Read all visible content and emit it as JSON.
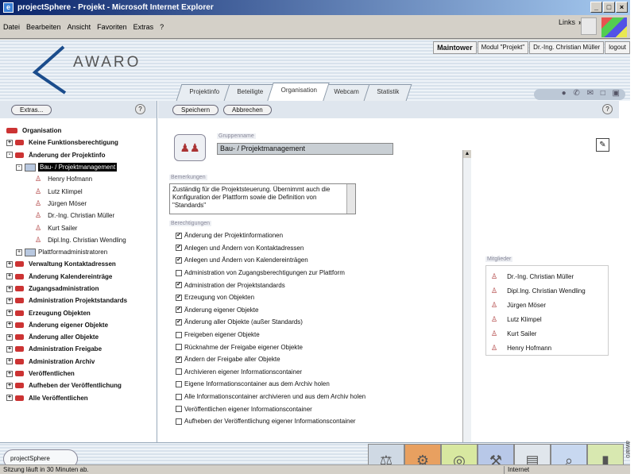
{
  "window": {
    "title": "projectSphere - Projekt - Microsoft Internet Explorer",
    "controls": [
      "_",
      "□",
      "×"
    ]
  },
  "menu": {
    "items": [
      "Datei",
      "Bearbeiten",
      "Ansicht",
      "Favoriten",
      "Extras",
      "?"
    ],
    "links": "Links",
    "links_chevron": "»"
  },
  "header": {
    "brand": "AWARO",
    "maintower": "Maintower",
    "modul": "Modul \"Projekt\"",
    "user": "Dr.-Ing. Christian Müller",
    "logout": "logout"
  },
  "tabs": [
    {
      "label": "Projektinfo"
    },
    {
      "label": "Beteiligte"
    },
    {
      "label": "Organisation"
    },
    {
      "label": "Webcam"
    },
    {
      "label": "Statistik"
    }
  ],
  "icons_strip": "● ✆ ✉ □ ▣",
  "left": {
    "extras": "Extras...",
    "help": "?",
    "root": "Organisation",
    "items": [
      {
        "label": "Keine Funktionsberechtigung",
        "type": "group",
        "level": 1
      },
      {
        "label": "Änderung der Projektinfo",
        "type": "group",
        "level": 1,
        "open": true
      },
      {
        "label": "Bau- / Projektmanagement",
        "type": "sub",
        "level": 2,
        "selected": true
      },
      {
        "label": "Henry Hofmann",
        "type": "person",
        "level": 3
      },
      {
        "label": "Lutz Klimpel",
        "type": "person",
        "level": 3
      },
      {
        "label": "Jürgen Möser",
        "type": "person",
        "level": 3
      },
      {
        "label": "Dr.-Ing. Christian Müller",
        "type": "person",
        "level": 3
      },
      {
        "label": "Kurt Sailer",
        "type": "person",
        "level": 3
      },
      {
        "label": "Dipl.Ing. Christian Wendling",
        "type": "person",
        "level": 3
      },
      {
        "label": "Plattformadministratoren",
        "type": "sub",
        "level": 2
      },
      {
        "label": "Verwaltung Kontaktadressen",
        "type": "group",
        "level": 1
      },
      {
        "label": "Änderung Kalendereinträge",
        "type": "group",
        "level": 1
      },
      {
        "label": "Zugangsadministration",
        "type": "group",
        "level": 1
      },
      {
        "label": "Administration Projektstandards",
        "type": "group",
        "level": 1
      },
      {
        "label": "Erzeugung Objekten",
        "type": "group",
        "level": 1
      },
      {
        "label": "Änderung eigener Objekte",
        "type": "group",
        "level": 1
      },
      {
        "label": "Änderung aller Objekte",
        "type": "group",
        "level": 1
      },
      {
        "label": "Administration Freigabe",
        "type": "group",
        "level": 1
      },
      {
        "label": "Administration Archiv",
        "type": "group",
        "level": 1
      },
      {
        "label": "Veröffentlichen",
        "type": "group",
        "level": 1
      },
      {
        "label": "Aufheben der Veröffentlichung",
        "type": "group",
        "level": 1
      },
      {
        "label": "Alle Veröffentlichen",
        "type": "group",
        "level": 1
      }
    ]
  },
  "main": {
    "save": "Speichern",
    "cancel": "Abbrechen",
    "help": "?",
    "groupname_label": "Gruppenname",
    "groupname": "Bau- / Projektmanagement",
    "desc_label": "Bemerkungen",
    "description": "Zuständig für die Projektsteuerung. Übernimmt auch die Konfiguration der Plattform sowie die Definition von \"Standards\"",
    "perms_label": "Berechtigungen",
    "members_label": "Mitglieder",
    "permissions": [
      {
        "label": "Änderung der Projektinformationen",
        "checked": true
      },
      {
        "label": "Anlegen und Ändern von Kontaktadressen",
        "checked": true
      },
      {
        "label": "Anlegen und Ändern von Kalendereinträgen",
        "checked": true
      },
      {
        "label": "Administration von Zugangsberechtigungen zur Plattform",
        "checked": false
      },
      {
        "label": "Administration der Projektstandards",
        "checked": true
      },
      {
        "label": "Erzeugung von Objekten",
        "checked": true
      },
      {
        "label": "Änderung eigener Objekte",
        "checked": true
      },
      {
        "label": "Änderung aller Objekte (außer Standards)",
        "checked": true
      },
      {
        "label": "Freigeben eigener Objekte",
        "checked": false
      },
      {
        "label": "Rücknahme der Freigabe eigener Objekte",
        "checked": false
      },
      {
        "label": "Ändern der Freigabe aller Objekte",
        "checked": true
      },
      {
        "label": "Archivieren eigener Informationscontainer",
        "checked": false
      },
      {
        "label": "Eigene Informationscontainer aus dem Archiv holen",
        "checked": false
      },
      {
        "label": "Alle Informationscontainer archivieren und aus dem Archiv holen",
        "checked": false
      },
      {
        "label": "Veröffentlichen eigener Informationscontainer",
        "checked": false
      },
      {
        "label": "Aufheben der Veröffentlichung eigener Informationscontainer",
        "checked": false
      }
    ],
    "members": [
      "Dr.-Ing. Christian Müller",
      "Dipl.Ing. Christian Wendling",
      "Jürgen Möser",
      "Lutz Klimpel",
      "Kurt Sailer",
      "Henry Hofmann"
    ]
  },
  "footer": {
    "brand": "projectSphere",
    "modules": [
      "⚖",
      "⚙",
      "◎",
      "⚒",
      "▤",
      "⌕",
      "▮"
    ],
    "module_colors": [
      "#cfd9e4",
      "#e8a060",
      "#d8e8a0",
      "#b8c8e8",
      "#e0e6ec",
      "#c8d8f0",
      "#d8e8b0"
    ]
  },
  "status": {
    "text": "Sitzung läuft in 30 Minuten ab.",
    "zone": "Internet"
  },
  "vertical_label": "awaro"
}
